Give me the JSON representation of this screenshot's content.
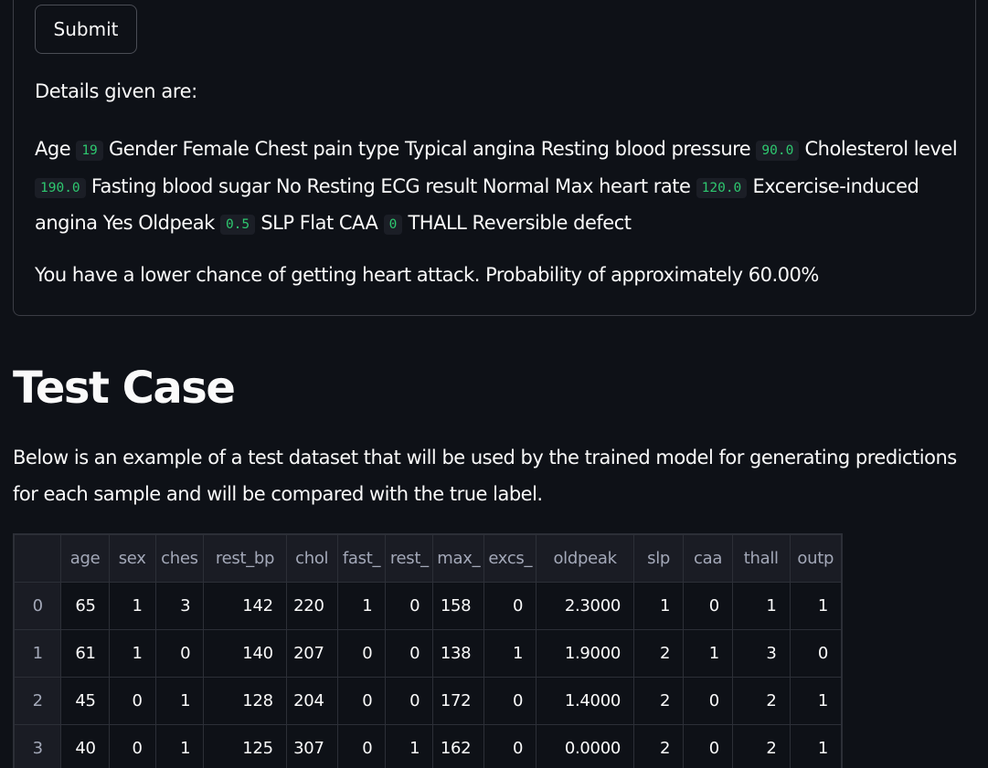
{
  "form": {
    "submit_label": "Submit",
    "details_heading": "Details given are:",
    "details": {
      "age_label": "Age",
      "age": "19",
      "gender_text": "Gender Female Chest pain type Typical angina Resting blood pressure",
      "resting_bp": "90.0",
      "cholesterol_label": "Cholesterol level",
      "cholesterol": "190.0",
      "middle_text": "Fasting blood sugar No Resting ECG result Normal Max heart rate",
      "max_heart_rate": "120.0",
      "exercise_text": "Excercise-induced angina Yes Oldpeak",
      "oldpeak": "0.5",
      "slp_caa_text": "SLP Flat CAA",
      "caa": "0",
      "thall_text": "THALL Reversible defect"
    },
    "result_text": "You have a lower chance of getting heart attack. Probability of approximately 60.00%"
  },
  "test_case": {
    "title": "Test Case",
    "description": "Below is an example of a test dataset that will be used by the trained model for generating predictions for each sample and will be compared with the true label."
  },
  "dataframe": {
    "columns": [
      "",
      "age",
      "sex",
      "ches",
      "rest_bp",
      "chol",
      "fast_",
      "rest_",
      "max_",
      "excs_",
      "oldpeak",
      "slp",
      "caa",
      "thall",
      "outp"
    ],
    "rows": [
      [
        "0",
        "65",
        "1",
        "3",
        "142",
        "220",
        "1",
        "0",
        "158",
        "0",
        "2.3000",
        "1",
        "0",
        "1",
        "1"
      ],
      [
        "1",
        "61",
        "1",
        "0",
        "140",
        "207",
        "0",
        "0",
        "138",
        "1",
        "1.9000",
        "2",
        "1",
        "3",
        "0"
      ],
      [
        "2",
        "45",
        "0",
        "1",
        "128",
        "204",
        "0",
        "0",
        "172",
        "0",
        "1.4000",
        "2",
        "0",
        "2",
        "1"
      ],
      [
        "3",
        "40",
        "0",
        "1",
        "125",
        "307",
        "0",
        "1",
        "162",
        "0",
        "0.0000",
        "2",
        "0",
        "2",
        "1"
      ]
    ]
  }
}
